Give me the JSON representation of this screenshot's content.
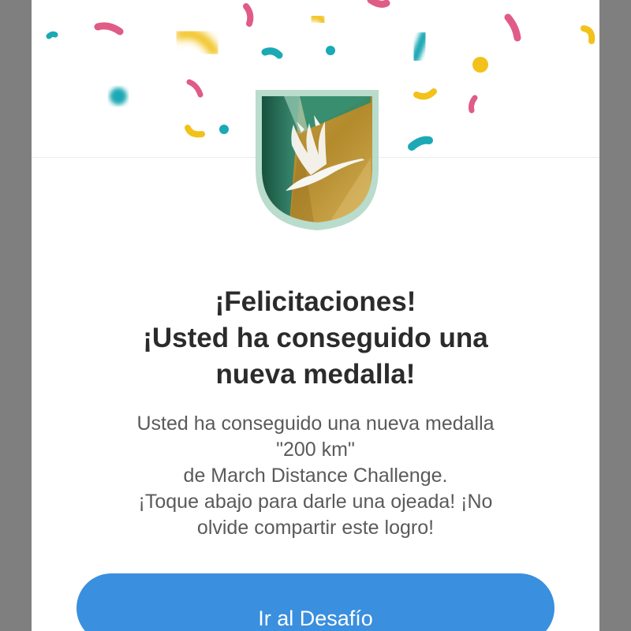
{
  "dialog": {
    "headline": [
      "¡Felicitaciones!",
      "¡Usted ha conseguido una",
      "nueva medalla!"
    ],
    "message": [
      "Usted ha conseguido una nueva medalla",
      "\"200 km\"",
      "de March Distance Challenge.",
      "¡Toque abajo para darle una ojeada! ¡No",
      "olvide compartir este logro!"
    ],
    "button_label": "Ir al Desafío"
  },
  "badge": {
    "icon": "crane-bird-icon"
  },
  "colors": {
    "button": "#3a8fde",
    "confetti_pink": "#e05b86",
    "confetti_teal": "#1aa9b5",
    "confetti_yellow": "#f2c21b",
    "badge_gold": "#b8902c",
    "badge_green": "#1f6e57",
    "badge_rim": "#b9dccd"
  }
}
